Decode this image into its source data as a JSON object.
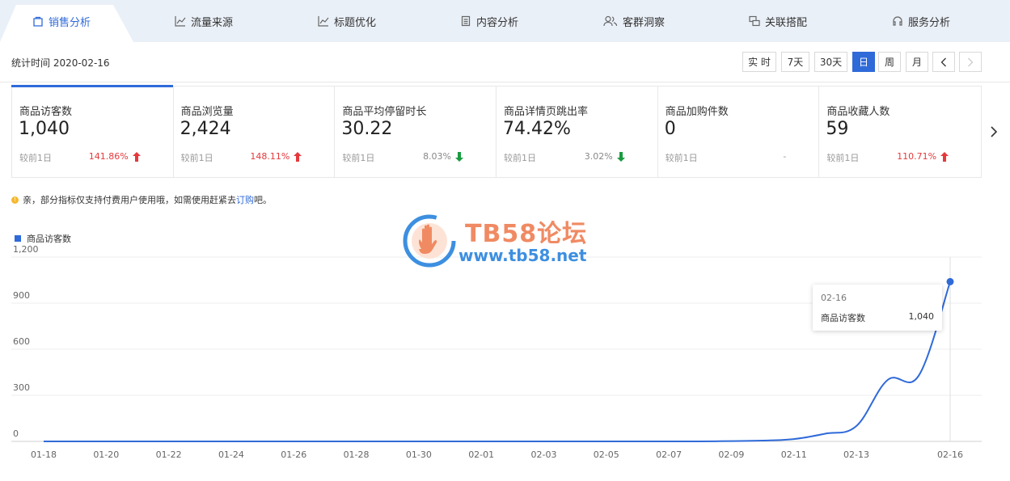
{
  "tabs": [
    {
      "label": "销售分析",
      "icon": "bag-icon",
      "active": true
    },
    {
      "label": "流量来源",
      "icon": "line-chart-icon"
    },
    {
      "label": "标题优化",
      "icon": "line-chart-icon"
    },
    {
      "label": "内容分析",
      "icon": "document-icon"
    },
    {
      "label": "客群洞察",
      "icon": "users-icon"
    },
    {
      "label": "关联搭配",
      "icon": "link-icon"
    },
    {
      "label": "服务分析",
      "icon": "headset-icon"
    }
  ],
  "header": {
    "stat_time": "统计时间 2020-02-16",
    "ranges": [
      "实 时",
      "7天",
      "30天",
      "日",
      "周",
      "月"
    ],
    "active_range": "日"
  },
  "metrics": [
    {
      "label": "商品访客数",
      "value": "1,040",
      "compare": "较前1日",
      "change": "141.86%",
      "dir": "up"
    },
    {
      "label": "商品浏览量",
      "value": "2,424",
      "compare": "较前1日",
      "change": "148.11%",
      "dir": "up"
    },
    {
      "label": "商品平均停留时长",
      "value": "30.22",
      "compare": "较前1日",
      "change": "8.03%",
      "dir": "down"
    },
    {
      "label": "商品详情页跳出率",
      "value": "74.42%",
      "compare": "较前1日",
      "change": "3.02%",
      "dir": "down"
    },
    {
      "label": "商品加购件数",
      "value": "0",
      "compare": "较前1日",
      "change": "-",
      "dir": "none"
    },
    {
      "label": "商品收藏人数",
      "value": "59",
      "compare": "较前1日",
      "change": "110.71%",
      "dir": "up"
    }
  ],
  "notice": {
    "icon": "warning-icon",
    "text_before": "亲，部分指标仅支持付费用户使用哦，如需使用赶紧去 ",
    "link": "订购",
    "text_after": "吧。"
  },
  "watermark": {
    "title": "TB58论坛",
    "url": "www.tb58.net"
  },
  "colors": {
    "accent": "#2f6ad9",
    "up": "#e5393c",
    "down": "#1a9b3f",
    "tab_bg": "#eaf0f8"
  },
  "chart_data": {
    "type": "line",
    "legend": "商品访客数",
    "x": [
      "01-18",
      "01-19",
      "01-20",
      "01-21",
      "01-22",
      "01-23",
      "01-24",
      "01-25",
      "01-26",
      "01-27",
      "01-28",
      "01-29",
      "01-30",
      "01-31",
      "02-01",
      "02-02",
      "02-03",
      "02-04",
      "02-05",
      "02-06",
      "02-07",
      "02-08",
      "02-09",
      "02-10",
      "02-11",
      "02-12",
      "02-13",
      "02-14",
      "02-15",
      "02-16"
    ],
    "values": [
      0,
      0,
      0,
      0,
      0,
      0,
      0,
      0,
      0,
      0,
      0,
      0,
      0,
      0,
      0,
      0,
      0,
      0,
      0,
      0,
      0,
      0,
      2,
      5,
      15,
      50,
      100,
      400,
      430,
      1040
    ],
    "x_tick_labels": [
      "01-18",
      "01-20",
      "01-22",
      "01-24",
      "01-26",
      "01-28",
      "01-30",
      "02-01",
      "02-03",
      "02-05",
      "02-07",
      "02-09",
      "02-11",
      "02-13",
      "02-16"
    ],
    "y_ticks": [
      "1,200",
      "900",
      "600",
      "300",
      "0"
    ],
    "ylim": [
      0,
      1200
    ],
    "grid": true,
    "tooltip": {
      "date": "02-16",
      "name": "商品访客数",
      "value": "1,040"
    }
  }
}
